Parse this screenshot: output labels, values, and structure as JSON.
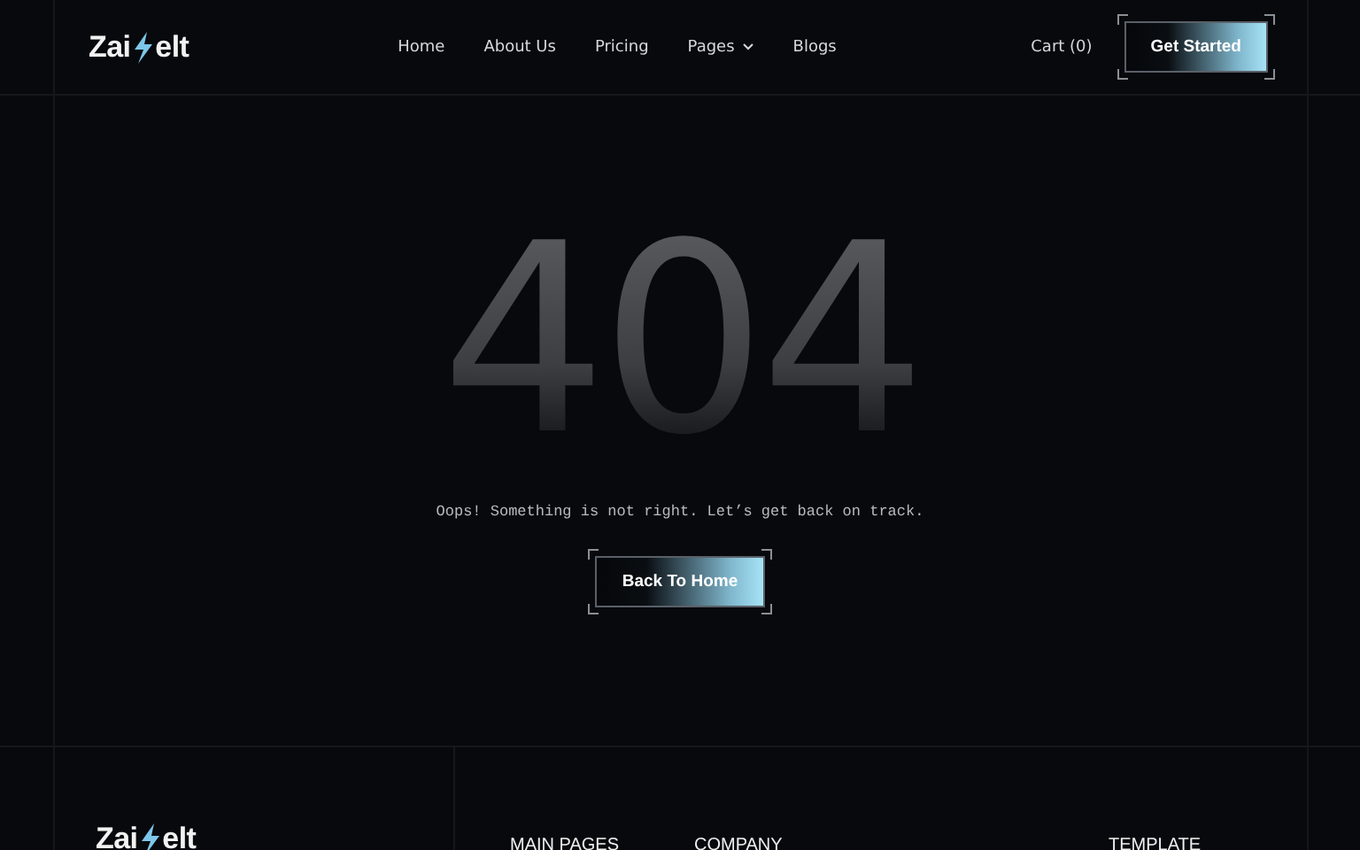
{
  "header": {
    "logo": {
      "before": "Zai",
      "after": "elt"
    },
    "nav": [
      {
        "label": "Home",
        "dropdown": false
      },
      {
        "label": "About Us",
        "dropdown": false
      },
      {
        "label": "Pricing",
        "dropdown": false
      },
      {
        "label": "Pages",
        "dropdown": true
      },
      {
        "label": "Blogs",
        "dropdown": false
      }
    ],
    "cart": "Cart (0)",
    "cta": "Get Started"
  },
  "error": {
    "code": "404",
    "message": "Oops! Something is not right. Let’s get back on track.",
    "button": "Back To Home"
  },
  "footer": {
    "logo": {
      "before": "Zai",
      "after": "elt"
    },
    "headings": [
      "MAIN PAGES",
      "COMPANY",
      "TEMPLATE"
    ]
  }
}
